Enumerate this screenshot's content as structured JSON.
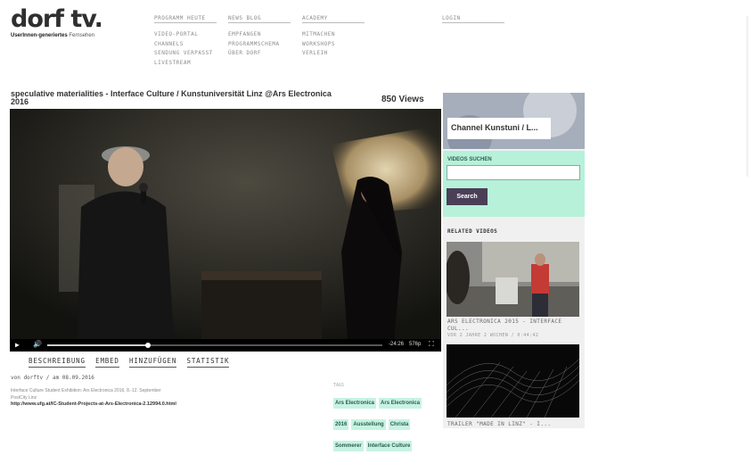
{
  "logo": {
    "main": "dorf tv.",
    "sub_bold": "UserInnen-generiertes",
    "sub_rest": " Fernsehen"
  },
  "nav": {
    "col1": {
      "top": "PROGRAMM HEUTE",
      "items": [
        "VIDEO-PORTAL",
        "CHANNELS",
        "SENDUNG VERPASST",
        "LIVESTREAM"
      ]
    },
    "col2": {
      "top": "NEWS BLOG",
      "items": [
        "EMPFANGEN",
        "PROGRAMMSCHEMA",
        "ÜBER DORF"
      ]
    },
    "col3": {
      "top": "ACADEMY",
      "items": [
        "MITMACHEN",
        "WORKSHOPS",
        "VERLEIH"
      ]
    },
    "col4": {
      "top": "LOGIN"
    }
  },
  "video": {
    "title": "speculative materialities - Interface Culture / Kunstuniversität Linz @Ars Electronica 2016",
    "views": "850 Views",
    "time_remaining": "-24:26",
    "quality": "576p",
    "progress": 0.3
  },
  "tabs": [
    "BESCHREIBUNG",
    "EMBED",
    "HINZUFÜGEN",
    "STATISTIK"
  ],
  "meta": "von dorftv / am 08.09.2016",
  "description": {
    "line1": "Interface Culture Student Exhibition: Ars Electronica 2016, 8.-12. September",
    "line2": "PostCity Linz",
    "link": "http://www.ufg.at/IC-Student-Projects-at-Ars-Electronica-2.12994.0.html"
  },
  "tags": {
    "label": "TAGS",
    "items": [
      "Ars Electronica",
      "Ars Electronica",
      "2016",
      "Ausstellung",
      "Christa",
      "Sommerer",
      "Interface Culture"
    ]
  },
  "sidebar": {
    "channel": "Channel Kunstuni / L...",
    "search_label": "VIDEOS SUCHEN",
    "search_button": "Search",
    "related_label": "RELATED VIDEOS",
    "related": [
      {
        "title": "ARS ELECTRONICA 2015 - INTERFACE",
        "title2": "CUL...",
        "meta": "VOR 2 JAHRE 2 WOCHEN / 0:44:42"
      },
      {
        "title": "TRAILER \"MADE IN LINZ\" - I..."
      }
    ]
  },
  "colors": {
    "accent_mint": "#b7f1da",
    "tag_bg": "#c7f3e3",
    "button": "#4a3f57"
  }
}
